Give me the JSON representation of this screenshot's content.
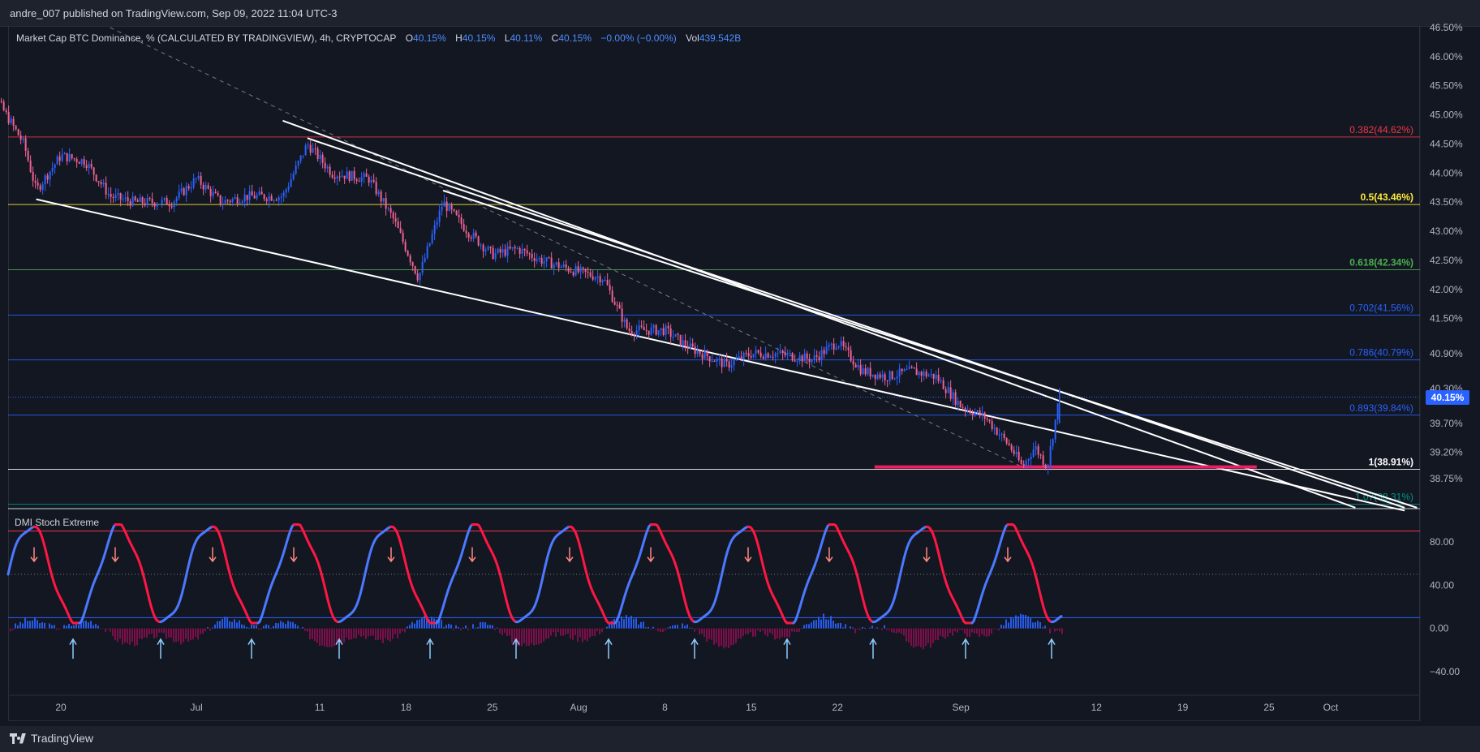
{
  "header": {
    "published_by": "andre_007 published on TradingView.com, Sep 09, 2022 11:04 UTC-3"
  },
  "legend": {
    "title": "Market Cap BTC Dominance, % (CALCULATED BY TRADINGVIEW), 4h, CRYPTOCAP",
    "o_label": "O",
    "o_value": "40.15%",
    "h_label": "H",
    "h_value": "40.15%",
    "l_label": "L",
    "l_value": "40.11%",
    "c_label": "C",
    "c_value": "40.15%",
    "change": "−0.00% (−0.00%)",
    "vol_label": "Vol",
    "vol_value": "439.542B"
  },
  "last_price_tag": "40.15%",
  "oscillator": {
    "title": "DMI Stoch Extreme",
    "y_ticks": [
      "80.00",
      "40.00",
      "0.00",
      "−40.00"
    ],
    "levels": [
      90,
      50,
      10
    ]
  },
  "footer": {
    "brand": "TradingView"
  },
  "colors": {
    "background": "#131722",
    "bull_candle": "#2962ff",
    "bear_candle": "#f06292",
    "trendline": "#ffffff",
    "support_highlight": "#e91e63",
    "osc_blue": "#2962ff",
    "osc_red": "#ff1744"
  },
  "chart_data": {
    "type": "line",
    "symbol": "Market Cap BTC Dominance, %",
    "interval": "4h",
    "y_axis_ticks": [
      "46.50%",
      "46.00%",
      "45.50%",
      "45.00%",
      "44.50%",
      "44.00%",
      "43.50%",
      "43.00%",
      "42.50%",
      "42.00%",
      "41.50%",
      "40.90%",
      "40.30%",
      "39.70%",
      "39.20%",
      "38.75%"
    ],
    "x_axis_ticks": [
      "20",
      "Jul",
      "11",
      "18",
      "25",
      "Aug",
      "8",
      "15",
      "22",
      "Sep",
      "12",
      "19",
      "25",
      "Oct"
    ],
    "fib_levels": [
      {
        "ratio": "0.382",
        "price": 44.62,
        "label": "0.382(44.62%)",
        "color": "#f23645"
      },
      {
        "ratio": "0.5",
        "price": 43.46,
        "label": "0.5(43.46%)",
        "color": "#ffeb3b"
      },
      {
        "ratio": "0.618",
        "price": 42.34,
        "label": "0.618(42.34%)",
        "color": "#4caf50"
      },
      {
        "ratio": "0.702",
        "price": 41.56,
        "label": "0.702(41.56%)",
        "color": "#2962ff"
      },
      {
        "ratio": "0.786",
        "price": 40.79,
        "label": "0.786(40.79%)",
        "color": "#2962ff"
      },
      {
        "ratio": "0.893",
        "price": 39.84,
        "label": "0.893(39.84%)",
        "color": "#2962ff"
      },
      {
        "ratio": "1",
        "price": 38.91,
        "label": "1(38.91%)",
        "color": "#ffffff"
      },
      {
        "ratio": "1.07",
        "price": 38.31,
        "label": "1.07(38.31%)",
        "color": "#009688"
      }
    ],
    "last_price": 40.15,
    "price_path": [
      [
        "Jun 13",
        45.7
      ],
      [
        "Jun 15",
        45.2
      ],
      [
        "Jun 17",
        44.5
      ],
      [
        "Jun 18",
        43.7
      ],
      [
        "Jun 20",
        44.3
      ],
      [
        "Jun 22",
        44.2
      ],
      [
        "Jun 24",
        43.6
      ],
      [
        "Jun 26",
        43.5
      ],
      [
        "Jun 29",
        43.5
      ],
      [
        "Jul 1",
        43.9
      ],
      [
        "Jul 3",
        43.5
      ],
      [
        "Jul 5",
        43.6
      ],
      [
        "Jul 8",
        43.6
      ],
      [
        "Jul 10",
        44.5
      ],
      [
        "Jul 12",
        44.0
      ],
      [
        "Jul 15",
        43.9
      ],
      [
        "Jul 17",
        43.2
      ],
      [
        "Jul 19",
        42.2
      ],
      [
        "Jul 21",
        43.5
      ],
      [
        "Jul 23",
        43.0
      ],
      [
        "Jul 25",
        42.6
      ],
      [
        "Jul 27",
        42.7
      ],
      [
        "Jul 29",
        42.5
      ],
      [
        "Aug 1",
        42.3
      ],
      [
        "Aug 3",
        42.2
      ],
      [
        "Aug 5",
        41.3
      ],
      [
        "Aug 8",
        41.3
      ],
      [
        "Aug 10",
        41.0
      ],
      [
        "Aug 13",
        40.7
      ],
      [
        "Aug 15",
        40.9
      ],
      [
        "Aug 17",
        40.9
      ],
      [
        "Aug 20",
        40.8
      ],
      [
        "Aug 22",
        41.1
      ],
      [
        "Aug 24",
        40.6
      ],
      [
        "Aug 26",
        40.5
      ],
      [
        "Aug 28",
        40.6
      ],
      [
        "Aug 30",
        40.5
      ],
      [
        "Sep 1",
        40.0
      ],
      [
        "Sep 3",
        39.8
      ],
      [
        "Sep 5",
        39.3
      ],
      [
        "Sep 6",
        38.95
      ],
      [
        "Sep 7",
        39.3
      ],
      [
        "Sep 8",
        38.95
      ],
      [
        "Sep 9",
        40.15
      ]
    ],
    "trendlines": [
      {
        "from": [
          "Jun 18",
          43.55
        ],
        "to": [
          "Oct 7",
          38.2
        ]
      },
      {
        "from": [
          "Jul 8",
          44.9
        ],
        "to": [
          "Oct 3",
          38.25
        ]
      },
      {
        "from": [
          "Jul 10",
          44.6
        ],
        "to": [
          "Oct 7",
          38.25
        ]
      },
      {
        "from": [
          "Jul 21",
          43.7
        ],
        "to": [
          "Oct 8",
          38.25
        ]
      }
    ],
    "support_zone": {
      "from": "Aug 25",
      "to": "Sep 25",
      "price": 38.95
    },
    "grid": false
  }
}
